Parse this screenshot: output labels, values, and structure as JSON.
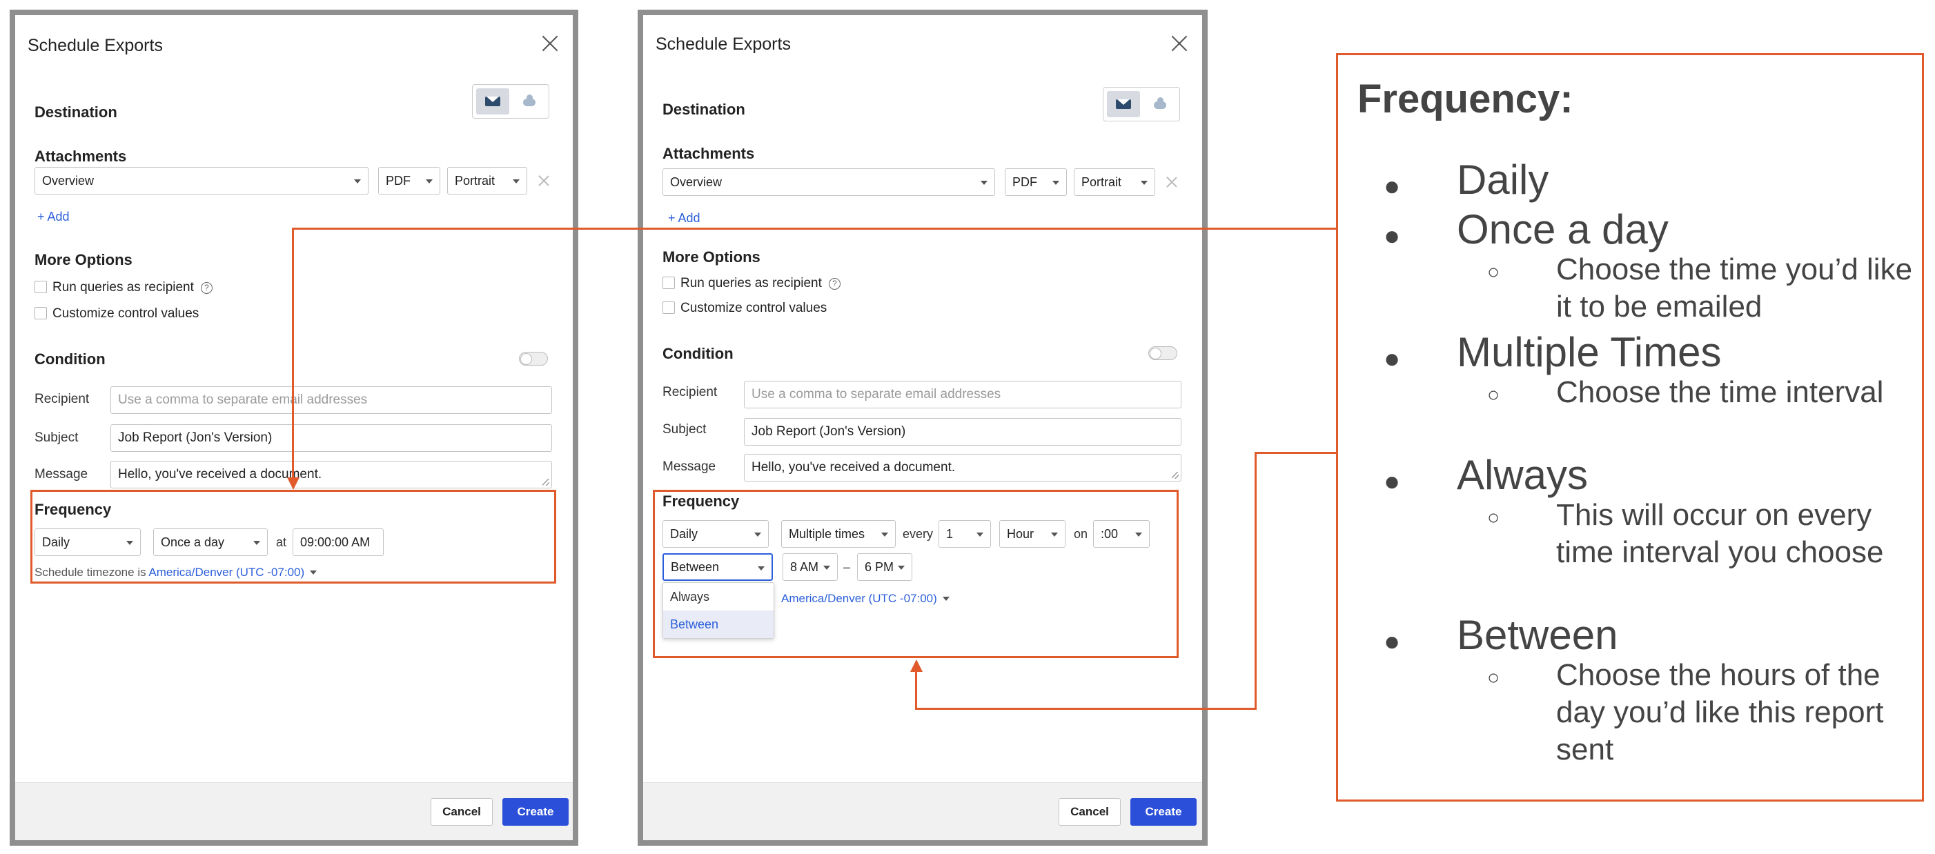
{
  "dialog": {
    "title": "Schedule Exports",
    "destination_label": "Destination",
    "attachments_label": "Attachments",
    "attachment": {
      "dashboard": "Overview",
      "format": "PDF",
      "orientation": "Portrait"
    },
    "add_label": "+ Add",
    "more_options_label": "More Options",
    "option_run_queries": "Run queries as recipient",
    "option_customize": "Customize control values",
    "condition_label": "Condition",
    "recipient_label": "Recipient",
    "recipient_placeholder": "Use a comma to separate email addresses",
    "subject_label": "Subject",
    "subject_value": "Job Report (Jon's Version)",
    "message_label": "Message",
    "message_value": "Hello, you've received a document.",
    "frequency_label": "Frequency",
    "cancel_label": "Cancel",
    "create_label": "Create"
  },
  "left_frequency": {
    "period": "Daily",
    "mode": "Once a day",
    "at_label": "at",
    "time": "09:00:00 AM",
    "timezone_prefix": "Schedule timezone is",
    "timezone": "America/Denver (UTC -07:00)"
  },
  "right_frequency": {
    "period": "Daily",
    "mode": "Multiple times",
    "every_label": "every",
    "interval": "1",
    "unit": "Hour",
    "on_label": "on",
    "minute": ":00",
    "window": "Between",
    "start_hour": "8 AM",
    "dash": "–",
    "end_hour": "6 PM",
    "timezone": "America/Denver (UTC -07:00)",
    "window_options": [
      "Always",
      "Between"
    ]
  },
  "callout": {
    "title": "Frequency:",
    "items": [
      {
        "label": "Daily"
      },
      {
        "label": "Once a day",
        "sub": "Choose the time you’d like it to be emailed"
      },
      {
        "label": "Multiple Times",
        "sub": "Choose the time interval"
      },
      {
        "label": "Always",
        "sub": "This will occur on every time interval you choose"
      },
      {
        "label": "Between",
        "sub": "Choose the hours of the day you’d like this report sent"
      }
    ]
  },
  "colors": {
    "accent": "#2b4fd8",
    "highlight": "#e05a2b",
    "frame": "#8f8f8f"
  },
  "icons": [
    "close-icon",
    "envelope-icon",
    "cloud-upload-icon",
    "help-icon",
    "chevron-down-icon",
    "remove-icon"
  ]
}
